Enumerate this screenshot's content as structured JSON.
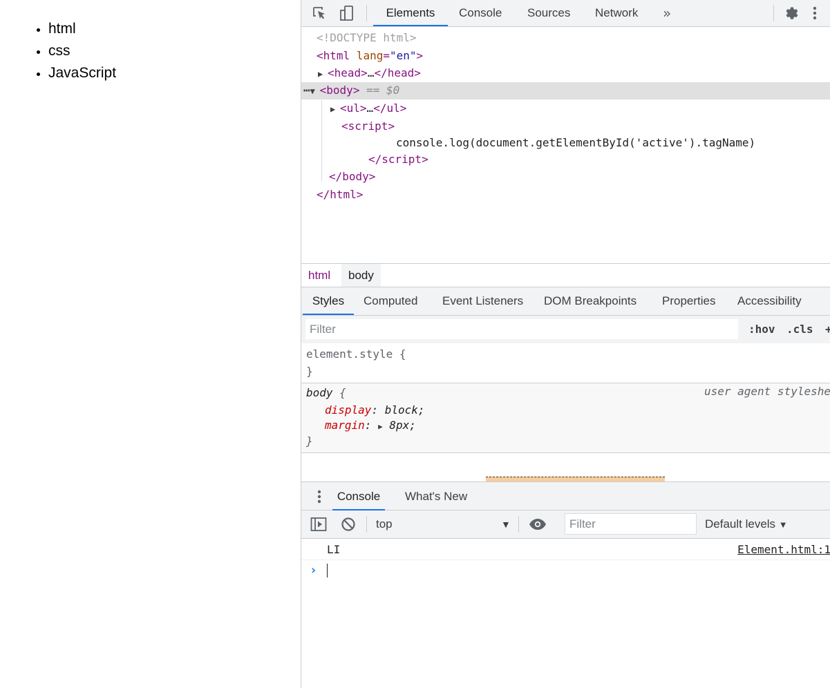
{
  "page": {
    "list_items": [
      "html",
      "css",
      "JavaScript"
    ]
  },
  "devtools": {
    "main_tabs": [
      "Elements",
      "Console",
      "Sources",
      "Network"
    ],
    "more_tabs": "»",
    "tree": {
      "doctype": "<!DOCTYPE html>",
      "html_open_tag": "html",
      "html_attr": "lang",
      "html_attr_value": "\"en\"",
      "head": "head",
      "head_ellipsis": "…",
      "body": "body",
      "body_marker": "== $0",
      "ul": "ul",
      "ul_ellipsis": "…",
      "script": "script",
      "script_code": "console.log(document.getElementById('active').tagName)",
      "close_script": "script",
      "close_body": "body",
      "close_html": "html"
    },
    "breadcrumbs": [
      "html",
      "body"
    ],
    "sidebar_tabs": [
      "Styles",
      "Computed",
      "Event Listeners",
      "DOM Breakpoints",
      "Properties",
      "Accessibility"
    ],
    "styles": {
      "filter_placeholder": "Filter",
      "hov": ":hov",
      "cls": ".cls",
      "element_style_selector": "element.style {",
      "element_style_close": "}",
      "body_selector": "body",
      "body_open": "{",
      "body_source": "user agent styleshe",
      "props": [
        {
          "name": "display",
          "value": "block;"
        },
        {
          "name": "margin",
          "value": "8px;"
        }
      ],
      "body_close": "}"
    },
    "drawer": {
      "tabs": [
        "Console",
        "What's New"
      ],
      "context": "top",
      "filter_placeholder": "Filter",
      "levels": "Default levels",
      "log": {
        "text": "LI",
        "source": "Element.html:1"
      },
      "prompt": "›"
    }
  }
}
